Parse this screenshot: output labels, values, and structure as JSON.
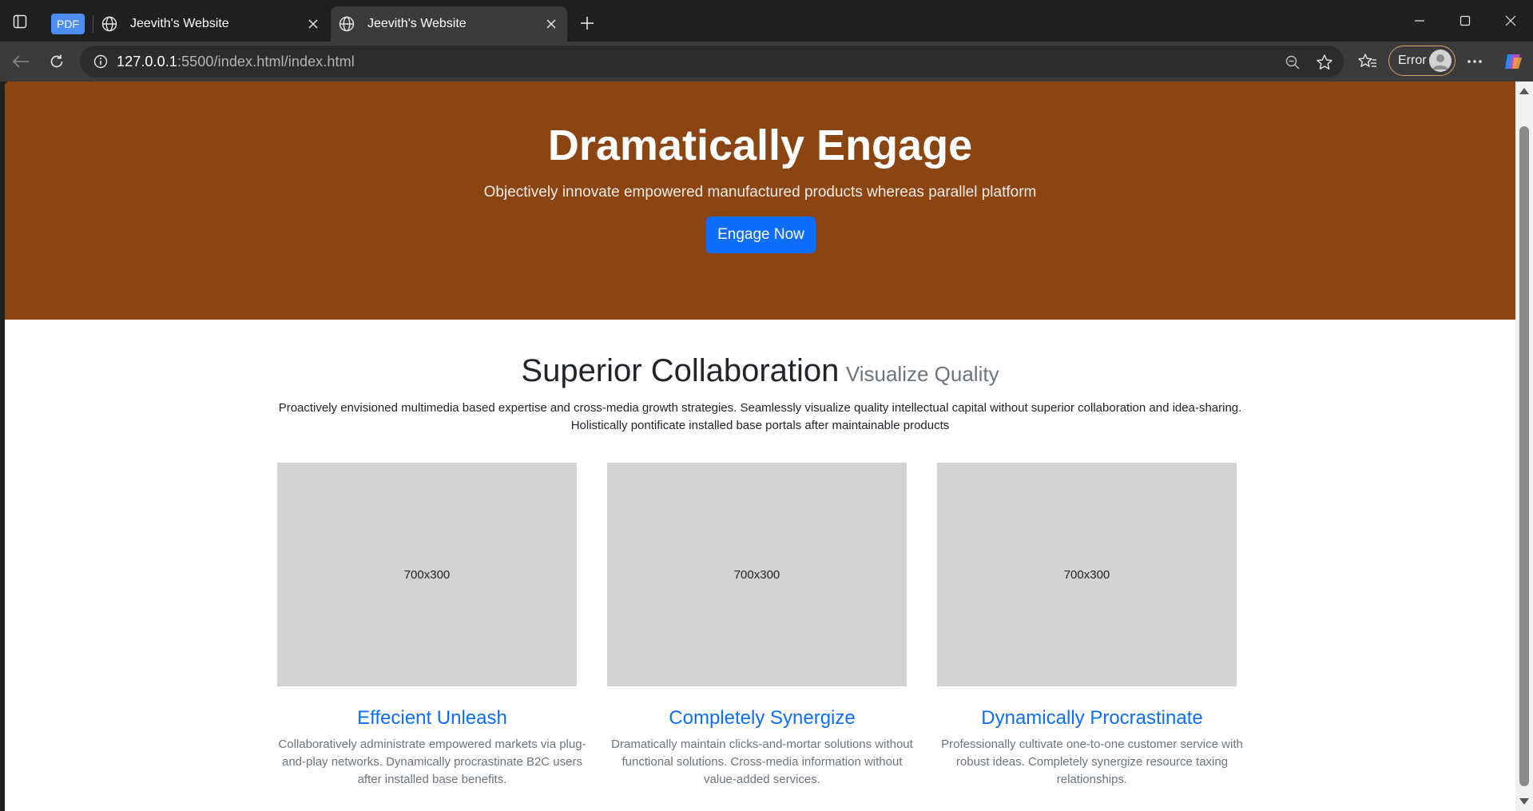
{
  "browser": {
    "tabs": [
      {
        "badge": "PDF",
        "title": "Jeevith's Website",
        "active": false
      },
      {
        "title": "Jeevith's Website",
        "active": true
      }
    ],
    "url_host": "127.0.0.1",
    "url_path": ":5500/index.html/index.html",
    "profile_label": "Error"
  },
  "hero": {
    "title": "Dramatically Engage",
    "subtitle": "Objectively innovate empowered manufactured products whereas parallel platform",
    "button_label": "Engage Now",
    "background_color": "#8b4513",
    "button_color": "#0d6efd"
  },
  "section": {
    "title": "Superior Collaboration",
    "subtitle": "Visualize Quality",
    "description": "Proactively envisioned multimedia based expertise and cross-media growth strategies. Seamlessly visualize quality intellectual capital without superior collaboration and idea-sharing. Holistically pontificate installed base portals after maintainable products"
  },
  "cards": [
    {
      "image_label": "700x300",
      "title": "Effecient Unleash",
      "text": "Collaboratively administrate empowered markets via plug-and-play networks. Dynamically procrastinate B2C users after installed base benefits."
    },
    {
      "image_label": "700x300",
      "title": "Completely Synergize",
      "text": "Dramatically maintain clicks-and-mortar solutions without functional solutions. Cross-media information without value-added services."
    },
    {
      "image_label": "700x300",
      "title": "Dynamically Procrastinate",
      "text": "Professionally cultivate one-to-one customer service with robust ideas. Completely synergize resource taxing relationships."
    }
  ]
}
